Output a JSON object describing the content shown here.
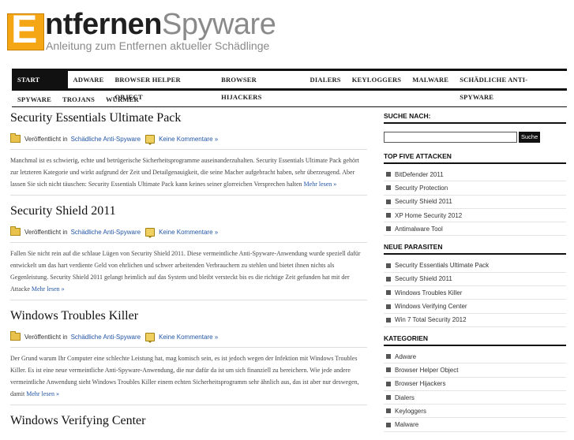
{
  "header": {
    "logo_letter": "E",
    "title_part1": "ntfernen",
    "title_part2": "Spyware",
    "tagline": "Anleitung zum Entfernen aktueller Schädlinge"
  },
  "nav": {
    "row1": [
      "Start Seite",
      "Adware",
      "Browser Helper Object",
      "Browser Hijackers",
      "Dialers",
      "Keyloggers",
      "Malware",
      "Schädliche Anti-Spyware"
    ],
    "row2": [
      "Spyware",
      "Trojans",
      "Würmer"
    ]
  },
  "meta_labels": {
    "published": "Veröffentlicht in",
    "category": "Schädliche Anti-Spyware",
    "comments": "Keine Kommentare »",
    "more": "Mehr lesen »"
  },
  "posts": [
    {
      "title": "Security Essentials Ultimate Pack",
      "excerpt": "Manchmal ist es schwierig, echte und betrügerische Sicherheitsprogramme auseinanderzuhalten. Security Essentials Ultimate Pack gehört zur letzteren Kategorie und wirkt aufgrund der Zeit und Detailgenauigkeit, die seine Macher aufgebracht haben, sehr überzeugend. Aber lassen Sie sich nicht täuschen: Security Essentials Ultimate Pack kann keines seiner glorreichen Versprechen halten"
    },
    {
      "title": "Security Shield 2011",
      "excerpt": "Fallen Sie nicht rein auf die schlaue Lügen von Security Shield 2011. Diese vermeintliche Anti-Spyware-Anwendung wurde speziell dafür entwickelt um das hart verdiente Geld von ehrlichen und schwer arbeitenden Verbrauchern zu stehlen und bietet ihnen nichts als Gegenleistung. Security Shield 2011 gelangt heimlich auf das System und bleibt versteckt bis es die richtige Zeit gefunden hat mit der Attacke"
    },
    {
      "title": "Windows Troubles Killer",
      "excerpt": "Der Grund warum Ihr Computer eine schlechte Leistung hat, mag komisch sein, es ist jedoch wegen der Infektion mit Windows Troubles Killer. Es ist eine neue vermeintliche Anti-Spyware-Anwendung, die nur dafür da ist um sich finanziell zu bereichern. Wie jede andere vermeintliche Anwendung sieht Windows Troubles Killer einem echten Sicherheitsprogramm sehr ähnlich aus, das ist aber nur deswegen, damit"
    },
    {
      "title": "Windows Verifying Center",
      "excerpt": ""
    }
  ],
  "sidebar": {
    "search_title": "Suche nach:",
    "search_button": "Suche",
    "top_title": "Top Five Attacken",
    "top_items": [
      "BitDefender 2011",
      "Security Protection",
      "Security Shield 2011",
      "XP Home Security 2012",
      "Antimalware Tool"
    ],
    "new_title": "Neue Parasiten",
    "new_items": [
      "Security Essentials Ultimate Pack",
      "Security Shield 2011",
      "Windows Troubles Killer",
      "Windows Verifying Center",
      "Win 7 Total Security 2012"
    ],
    "cat_title": "Kategorien",
    "cat_items": [
      "Adware",
      "Browser Helper Object",
      "Browser Hijackers",
      "Dialers",
      "Keyloggers",
      "Malware"
    ]
  }
}
